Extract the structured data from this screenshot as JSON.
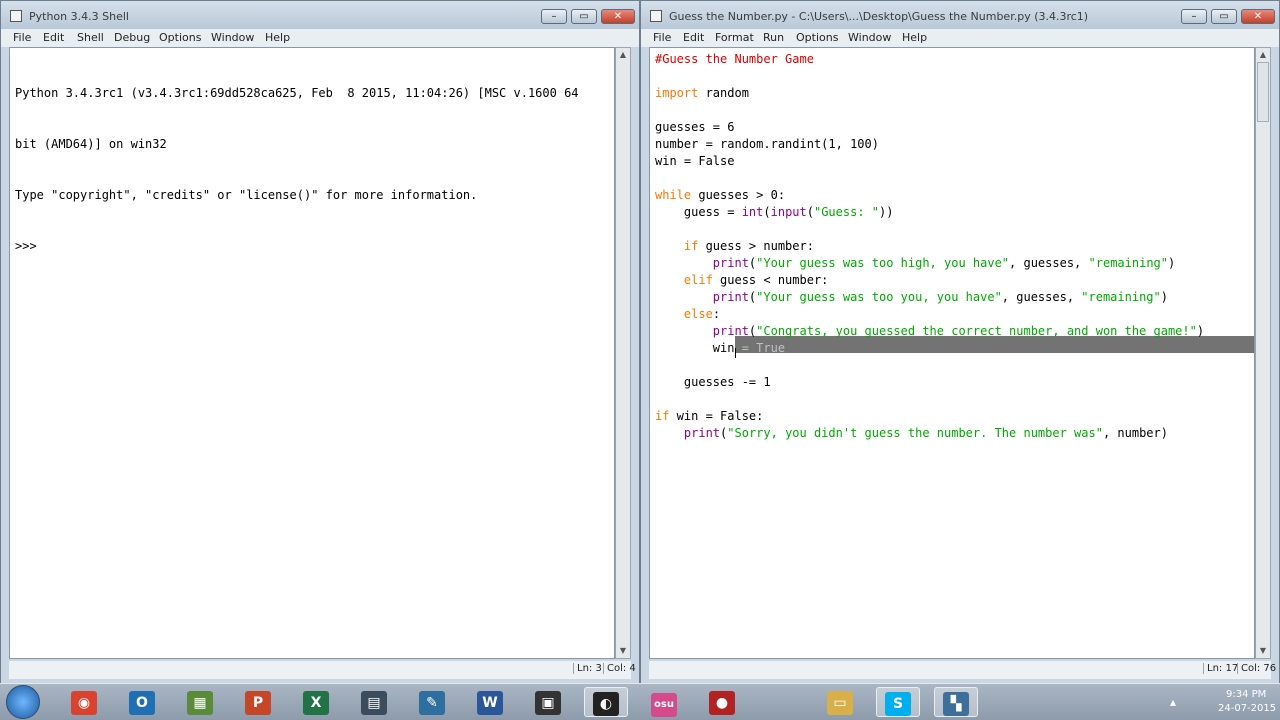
{
  "shell_window": {
    "title": "Python 3.4.3 Shell",
    "menu": [
      "File",
      "Edit",
      "Shell",
      "Debug",
      "Options",
      "Window",
      "Help"
    ],
    "lines": [
      "Python 3.4.3rc1 (v3.4.3rc1:69dd528ca625, Feb  8 2015, 11:04:26) [MSC v.1600 64",
      "bit (AMD64)] on win32",
      "Type \"copyright\", \"credits\" or \"license()\" for more information.",
      ">>> "
    ],
    "status": {
      "line": "Ln: 3",
      "col": "Col: 4"
    }
  },
  "editor_window": {
    "title": "Guess the Number.py - C:\\Users\\...\\Desktop\\Guess the Number.py (3.4.3rc1)",
    "menu": [
      "File",
      "Edit",
      "Format",
      "Run",
      "Options",
      "Window",
      "Help"
    ],
    "status": {
      "line": "Ln: 17",
      "col": "Col: 76"
    },
    "code": [
      [
        {
          "t": "#Guess the Number Game",
          "c": "c-com"
        }
      ],
      [],
      [
        {
          "t": "import",
          "c": "c-kw"
        },
        {
          "t": " random"
        }
      ],
      [],
      [
        {
          "t": "guesses = 6"
        }
      ],
      [
        {
          "t": "number = random.randint(1, 100)"
        }
      ],
      [
        {
          "t": "win = False"
        }
      ],
      [],
      [
        {
          "t": "while",
          "c": "c-kw"
        },
        {
          "t": " guesses > 0:"
        }
      ],
      [
        {
          "t": "    guess = "
        },
        {
          "t": "int",
          "c": "c-bi"
        },
        {
          "t": "("
        },
        {
          "t": "input",
          "c": "c-bi"
        },
        {
          "t": "("
        },
        {
          "t": "\"Guess: \"",
          "c": "c-str"
        },
        {
          "t": "))"
        }
      ],
      [],
      [
        {
          "t": "    "
        },
        {
          "t": "if",
          "c": "c-kw"
        },
        {
          "t": " guess > number:"
        }
      ],
      [
        {
          "t": "        "
        },
        {
          "t": "print",
          "c": "c-bi"
        },
        {
          "t": "("
        },
        {
          "t": "\"Your guess was too high, you have\"",
          "c": "c-str"
        },
        {
          "t": ", guesses, "
        },
        {
          "t": "\"remaining\"",
          "c": "c-str"
        },
        {
          "t": ")"
        }
      ],
      [
        {
          "t": "    "
        },
        {
          "t": "elif",
          "c": "c-kw"
        },
        {
          "t": " guess < number:"
        }
      ],
      [
        {
          "t": "        "
        },
        {
          "t": "print",
          "c": "c-bi"
        },
        {
          "t": "("
        },
        {
          "t": "\"Your guess was too you, you have\"",
          "c": "c-str"
        },
        {
          "t": ", guesses, "
        },
        {
          "t": "\"remaining\"",
          "c": "c-str"
        },
        {
          "t": ")"
        }
      ],
      [
        {
          "t": "    "
        },
        {
          "t": "else",
          "c": "c-kw"
        },
        {
          "t": ":"
        }
      ],
      [
        {
          "t": "        "
        },
        {
          "t": "print",
          "c": "c-bi"
        },
        {
          "t": "("
        },
        {
          "t": "\"Congrats, you guessed the correct number, and won the game!\"",
          "c": "c-str"
        },
        {
          "t": ")"
        }
      ],
      [
        {
          "t": "        win"
        },
        {
          "t": " = True",
          "c": "sel-text"
        }
      ],
      [],
      [
        {
          "t": "    guesses -= 1"
        }
      ],
      [],
      [
        {
          "t": "if",
          "c": "c-kw"
        },
        {
          "t": " win = False:"
        }
      ],
      [
        {
          "t": "    "
        },
        {
          "t": "print",
          "c": "c-bi"
        },
        {
          "t": "("
        },
        {
          "t": "\"Sorry, you didn't guess the number. The number was\"",
          "c": "c-str"
        },
        {
          "t": ", number)"
        }
      ]
    ]
  },
  "taskbar": {
    "items": [
      {
        "name": "chrome-icon",
        "glyph": "◉",
        "bg": "#d9422f"
      },
      {
        "name": "outlook-icon",
        "glyph": "O",
        "bg": "#1f6fb5"
      },
      {
        "name": "minecraft-icon",
        "glyph": "▦",
        "bg": "#5a8a3a"
      },
      {
        "name": "powerpoint-icon",
        "glyph": "P",
        "bg": "#c5472a"
      },
      {
        "name": "excel-icon",
        "glyph": "X",
        "bg": "#217346"
      },
      {
        "name": "media-icon",
        "glyph": "▤",
        "bg": "#3d4c5c"
      },
      {
        "name": "notepad-icon",
        "glyph": "✎",
        "bg": "#2f6f9f"
      },
      {
        "name": "word-icon",
        "glyph": "W",
        "bg": "#2b579a"
      },
      {
        "name": "capture-icon",
        "glyph": "▣",
        "bg": "#333"
      },
      {
        "name": "obs-icon",
        "glyph": "◐",
        "bg": "#222"
      },
      {
        "name": "osu-icon",
        "glyph": "osu",
        "bg": "#d44a8a"
      },
      {
        "name": "red-app-icon",
        "glyph": "●",
        "bg": "#b22222"
      },
      {
        "name": "explorer-icon",
        "glyph": "▭",
        "bg": "#d8b04a"
      },
      {
        "name": "skype-icon",
        "glyph": "S",
        "bg": "#00aff0"
      },
      {
        "name": "python-idle-icon",
        "glyph": "▚",
        "bg": "#3d6f9a"
      }
    ],
    "time": "9:34 PM",
    "date": "24-07-2015"
  }
}
